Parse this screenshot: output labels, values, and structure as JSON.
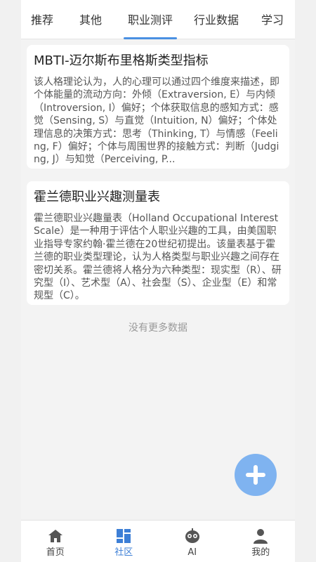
{
  "tabs": [
    {
      "label": "推荐"
    },
    {
      "label": "其他"
    },
    {
      "label": "职业测评"
    },
    {
      "label": "行业数据"
    },
    {
      "label": "学习"
    }
  ],
  "active_tab": 2,
  "cards": [
    {
      "title": "MBTI-迈尔斯布里格斯类型指标",
      "desc": "该人格理论认为，人的心理可以通过四个维度来描述，即个体能量的流动方向：外倾（Extraversion, E）与内倾（Introversion, I）偏好；个体获取信息的感知方式：感觉（Sensing, S）与直觉（Intuition, N）偏好；个体处理信息的决策方式：思考（Thinking, T）与情感（Feeling, F）偏好；个体与周围世界的接触方式：判断（Judging, J）与知觉（Perceiving, P..."
    },
    {
      "title": "霍兰德职业兴趣测量表",
      "desc": "霍兰德职业兴趣量表（Holland Occupational Interest Scale）是一种用于评估个人职业兴趣的工具，由美国职业指导专家约翰·霍兰德在20世纪初提出。该量表基于霍兰德的职业类型理论，认为人格类型与职业兴趣之间存在密切关系。霍兰德将人格分为六种类型：现实型（R）、研究型（I）、艺术型（A）、社会型（S）、企业型（E）和常规型（C）。"
    }
  ],
  "no_more_text": "没有更多数据",
  "bottom_nav": [
    {
      "label": "首页",
      "icon": "home-icon"
    },
    {
      "label": "社区",
      "icon": "community-icon"
    },
    {
      "label": "AI",
      "icon": "robot-icon"
    },
    {
      "label": "我的",
      "icon": "user-icon"
    }
  ],
  "active_nav": 1,
  "colors": {
    "accent": "#4a90e2",
    "fab": "#7fb3f0",
    "nav_active": "#3d7fd6",
    "nav_inactive": "#444444"
  }
}
